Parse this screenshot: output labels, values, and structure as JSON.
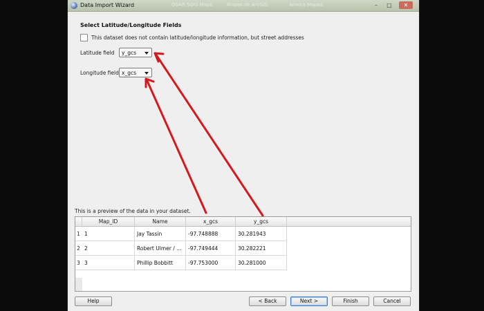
{
  "window": {
    "title": "Data Import Wizard",
    "background_tabs": [
      "OSAR SGIS Maps",
      "Mapas de ArcGIS",
      "Ameca Mapas"
    ],
    "controls": {
      "minimize": "–",
      "maximize": "□",
      "close": "✕"
    }
  },
  "page": {
    "heading": "Select Latitude/Longitude Fields",
    "address_checkbox": {
      "label": "This dataset does not contain latitude/longitude information, but street addresses",
      "checked": false
    },
    "latitude": {
      "label": "Latitude field",
      "value": "y_gcs"
    },
    "longitude": {
      "label": "Longitude field",
      "value": "x_gcs"
    }
  },
  "preview": {
    "label": "This is a preview of the data in your dataset.",
    "columns": [
      "Map_ID",
      "Name",
      "x_gcs",
      "y_gcs"
    ],
    "rows": [
      {
        "num": "1",
        "cells": [
          "1",
          "Jay Tassin",
          "-97.748888",
          "30.281943"
        ]
      },
      {
        "num": "2",
        "cells": [
          "2",
          "Robert Ulmer / ...",
          "-97.749444",
          "30.282221"
        ]
      },
      {
        "num": "3",
        "cells": [
          "3",
          "Phillip Bobbitt",
          "-97.753000",
          "30.281000"
        ]
      }
    ]
  },
  "buttons": {
    "help": "Help",
    "back": "< Back",
    "next": "Next >",
    "finish": "Finish",
    "cancel": "Cancel"
  },
  "colors": {
    "annotation_arrow": "#d6171c",
    "dialog_bg": "#efefef"
  }
}
